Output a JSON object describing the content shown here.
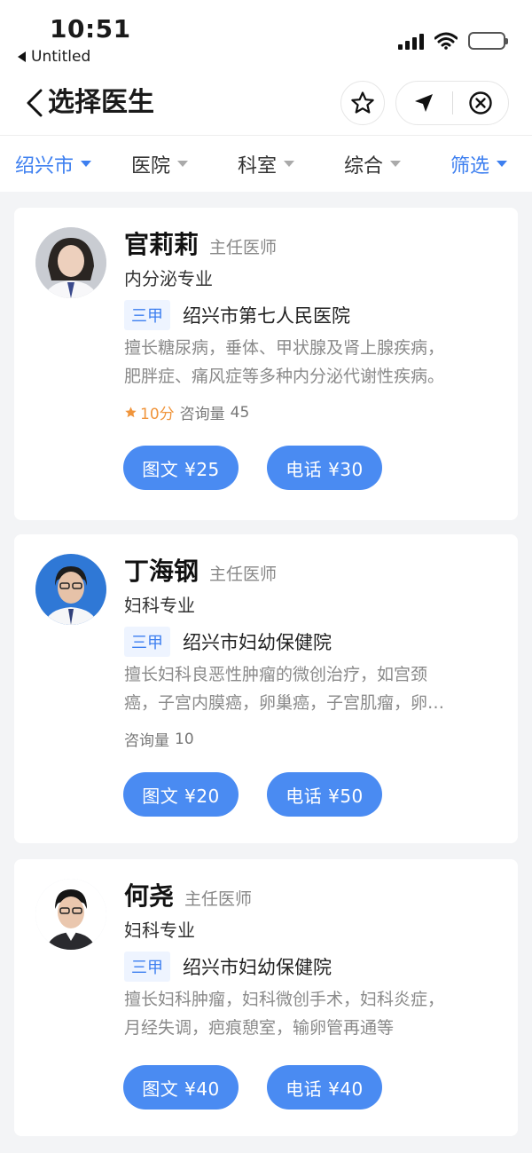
{
  "status": {
    "time": "10:51",
    "back_app": "Untitled"
  },
  "nav": {
    "title": "选择医生"
  },
  "filters": [
    {
      "label": "绍兴市",
      "active": true
    },
    {
      "label": "医院",
      "active": false
    },
    {
      "label": "科室",
      "active": false
    },
    {
      "label": "综合",
      "active": false
    },
    {
      "label": "筛选",
      "active": true
    }
  ],
  "doctors": [
    {
      "name": "官莉莉",
      "title": "主任医师",
      "specialty": "内分泌专业",
      "grade": "三甲",
      "hospital": "绍兴市第七人民医院",
      "desc_line1": "擅长糖尿病，垂体、甲状腺及肾上腺疾病，",
      "desc_line2": "肥胖症、痛风症等多种内分泌代谢性疾病。",
      "score": "10分",
      "consult_label": "咨询量",
      "consult_count": "45",
      "btn_text": "图文 ¥25",
      "btn_phone": "电话 ¥30"
    },
    {
      "name": "丁海钢",
      "title": "主任医师",
      "specialty": "妇科专业",
      "grade": "三甲",
      "hospital": "绍兴市妇幼保健院",
      "desc_line1": "擅长妇科良恶性肿瘤的微创治疗，如宫颈",
      "desc_line2": "癌，子宫内膜癌，卵巢癌，子宫肌瘤，卵…",
      "consult_label": "咨询量",
      "consult_count": "10",
      "btn_text": "图文 ¥20",
      "btn_phone": "电话 ¥50"
    },
    {
      "name": "何尧",
      "title": "主任医师",
      "specialty": "妇科专业",
      "grade": "三甲",
      "hospital": "绍兴市妇幼保健院",
      "desc_line1": "擅长妇科肿瘤，妇科微创手术，妇科炎症，",
      "desc_line2": "月经失调，疤痕憩室，输卵管再通等",
      "btn_text": "图文 ¥40",
      "btn_phone": "电话 ¥40"
    }
  ],
  "colors": {
    "accent": "#3d7ff0",
    "button": "#4a8bf2",
    "score": "#f0953c",
    "background": "#f3f4f6"
  }
}
